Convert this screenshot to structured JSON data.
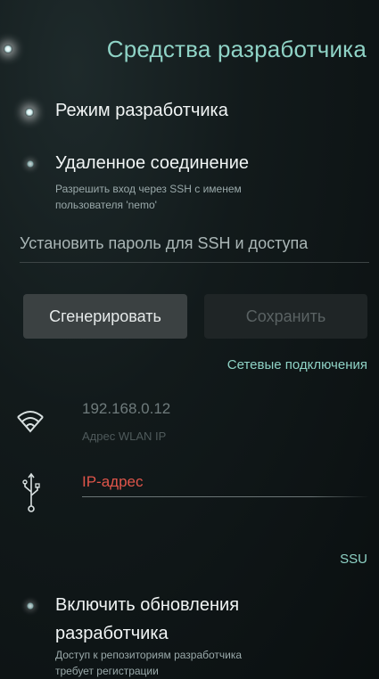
{
  "header": {
    "title": "Средства разработчика"
  },
  "developer_mode": {
    "label": "Режим разработчика"
  },
  "remote_connection": {
    "label": "Удаленное соединение",
    "description_line1": "Разрешить вход через SSH с именем",
    "description_line2": "пользователя 'nemo'"
  },
  "ssh_password": {
    "placeholder": "Установить пароль для SSH и доступа"
  },
  "buttons": {
    "generate": "Сгенерировать",
    "save": "Сохранить"
  },
  "network": {
    "section_label": "Сетевые подключения",
    "wlan_ip": "192.168.0.12",
    "wlan_label": "Адрес WLAN IP",
    "usb_ip_label": "IP-адрес"
  },
  "ssu": {
    "section_label": "SSU",
    "updates_label_line1": "Включить обновления",
    "updates_label_line2": "разработчика",
    "updates_desc_line1": "Доступ к репозиториям разработчика",
    "updates_desc_line2": "требует регистрации"
  },
  "colors": {
    "accent": "#8fd3c6",
    "error": "#e0554a"
  }
}
